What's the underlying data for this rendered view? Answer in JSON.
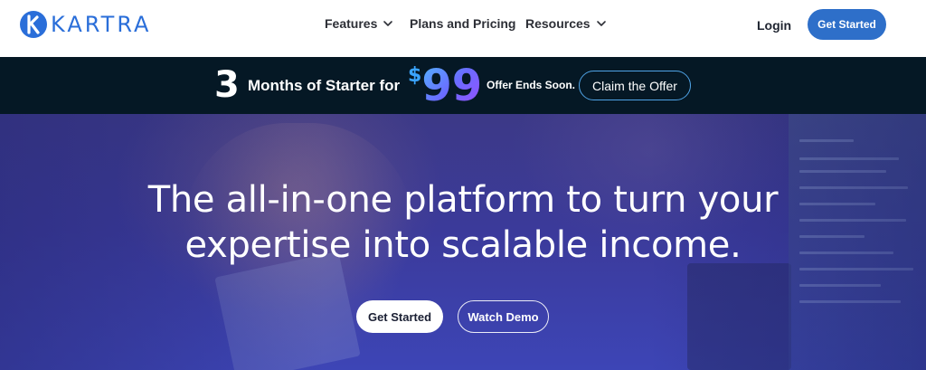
{
  "brand": {
    "name": "KARTRA",
    "accent_color": "#2a6ed9",
    "logo_icon": "kartra-k-icon"
  },
  "nav": {
    "items": [
      {
        "label": "Features",
        "icon": "chevron-down-icon"
      },
      {
        "label": "Plans and Pricing"
      },
      {
        "label": "Resources",
        "icon": "chevron-down-icon"
      }
    ],
    "login_label": "Login",
    "cta_label": "Get Started",
    "cta_color": "#2e6fc9"
  },
  "promo": {
    "big_number": "3",
    "text": "Months of Starter for",
    "currency": "$",
    "price": "99",
    "ends_text": "Offer Ends Soon.",
    "button_label": "Claim the Offer",
    "background": "#051825"
  },
  "hero": {
    "title_line1": "The all-in-one platform to turn your",
    "title_line2": "expertise into scalable income.",
    "primary_label": "Get Started",
    "secondary_label": "Watch Demo"
  }
}
